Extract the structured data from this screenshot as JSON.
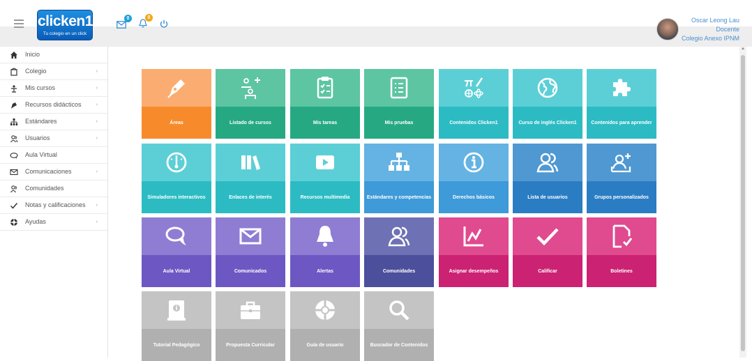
{
  "header": {
    "logo": {
      "brand": "clicken1",
      "slogan": "Tu colegio en un click"
    },
    "mail_badge": "0",
    "bell_badge": "0",
    "user": {
      "name": "Oscar Leong Lau",
      "role": "Docente",
      "school": "Colegio Anexo IPNM"
    }
  },
  "colors": {
    "mail_badge": "#1fa0d8",
    "bell_badge": "#f0a818",
    "power_icon": "#3b8ed8",
    "user_text": "#4a8fd0"
  },
  "sidebar": {
    "items": [
      {
        "label": "Inicio",
        "icon": "home-icon",
        "chevron": ""
      },
      {
        "label": "Colegio",
        "icon": "school-icon",
        "chevron": "›"
      },
      {
        "label": "Mis cursos",
        "icon": "courses-icon",
        "chevron": "›"
      },
      {
        "label": "Recursos didácticos",
        "icon": "resources-icon",
        "chevron": "›"
      },
      {
        "label": "Estándares",
        "icon": "standards-icon",
        "chevron": "›"
      },
      {
        "label": "Usuarios",
        "icon": "users-icon",
        "chevron": "›"
      },
      {
        "label": "Aula Virtual",
        "icon": "chat-icon",
        "chevron": ""
      },
      {
        "label": "Comunicaciones",
        "icon": "mail-icon",
        "chevron": "›"
      },
      {
        "label": "Comunidades",
        "icon": "community-icon",
        "chevron": ""
      },
      {
        "label": "Notas y calificaciones",
        "icon": "check-icon",
        "chevron": "›"
      },
      {
        "label": "Ayudas",
        "icon": "lifebuoy-icon",
        "chevron": "›"
      }
    ]
  },
  "tiles": [
    {
      "label": "Áreas",
      "icon": "pen-icon",
      "top": "#fbad71",
      "bottom": "#f78b2c"
    },
    {
      "label": "Listado de cursos",
      "icon": "course-list-icon",
      "top": "#5dc5a2",
      "bottom": "#26a982"
    },
    {
      "label": "Mis tareas",
      "icon": "clipboard-icon",
      "top": "#5dc5a2",
      "bottom": "#26a982"
    },
    {
      "label": "Mis pruebas",
      "icon": "test-list-icon",
      "top": "#5dc5a2",
      "bottom": "#26a982"
    },
    {
      "label": "Contenidos Clicken1",
      "icon": "science-icon",
      "top": "#5ccfd6",
      "bottom": "#2cbbc3"
    },
    {
      "label": "Curso de inglés Clicken1",
      "icon": "globe-icon",
      "top": "#5ccfd6",
      "bottom": "#2cbbc3"
    },
    {
      "label": "Contenidos para aprender",
      "icon": "puzzle-icon",
      "top": "#5ccfd6",
      "bottom": "#2cbbc3"
    },
    {
      "label": "Simuladores interactivos",
      "icon": "gauge-icon",
      "top": "#5ccfd6",
      "bottom": "#2cbbc3"
    },
    {
      "label": "Enlaces de interés",
      "icon": "books-icon",
      "top": "#5ccfd6",
      "bottom": "#2cbbc3"
    },
    {
      "label": "Recursos multimedia",
      "icon": "play-icon",
      "top": "#5ccfd6",
      "bottom": "#2cbbc3"
    },
    {
      "label": "Estándares y competencias",
      "icon": "hierarchy-icon",
      "top": "#64b3e3",
      "bottom": "#3e9ad8"
    },
    {
      "label": "Derechos básicos",
      "icon": "info-icon",
      "top": "#64b3e3",
      "bottom": "#3e9ad8"
    },
    {
      "label": "Lista de usuarios",
      "icon": "users-icon",
      "top": "#4f98d2",
      "bottom": "#2a7dc3"
    },
    {
      "label": "Grupos personalizados",
      "icon": "add-user-icon",
      "top": "#4f98d2",
      "bottom": "#2a7dc3"
    },
    {
      "label": "Aula Virtual",
      "icon": "chat-icon",
      "top": "#8f7dd3",
      "bottom": "#6d58c3"
    },
    {
      "label": "Comunicados",
      "icon": "mail-icon",
      "top": "#8f7dd3",
      "bottom": "#6d58c3"
    },
    {
      "label": "Alertas",
      "icon": "bell-icon",
      "top": "#8f7dd3",
      "bottom": "#6d58c3"
    },
    {
      "label": "Comunidades",
      "icon": "community-icon",
      "top": "#6e72b4",
      "bottom": "#4b4f9c"
    },
    {
      "label": "Asignar desempeños",
      "icon": "chart-icon",
      "top": "#e04a8f",
      "bottom": "#cc2273"
    },
    {
      "label": "Calificar",
      "icon": "check-icon",
      "top": "#e04a8f",
      "bottom": "#cc2273"
    },
    {
      "label": "Boletines",
      "icon": "document-icon",
      "top": "#e04a8f",
      "bottom": "#cc2273"
    },
    {
      "label": "Tutorial Pedagógico",
      "icon": "tutorial-icon",
      "top": "#c4c4c4",
      "bottom": "#b0b0b0"
    },
    {
      "label": "Propuesta Curricular",
      "icon": "briefcase-icon",
      "top": "#c4c4c4",
      "bottom": "#b0b0b0"
    },
    {
      "label": "Guía de usuario",
      "icon": "lifebuoy-icon",
      "top": "#c4c4c4",
      "bottom": "#b0b0b0"
    },
    {
      "label": "Buscador de Contenidos",
      "icon": "search-icon",
      "top": "#c4c4c4",
      "bottom": "#b0b0b0"
    }
  ]
}
